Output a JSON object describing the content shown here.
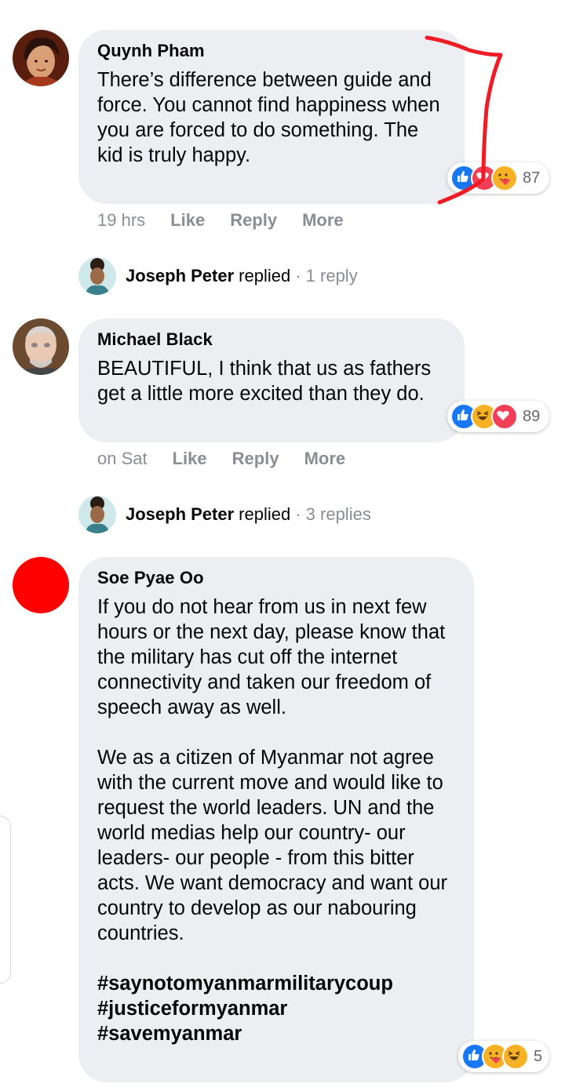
{
  "comments": [
    {
      "author": "Quynh Pham",
      "text": [
        "There’s difference between guide and force. You cannot find happiness when you are forced to do something. The kid is truly happy."
      ],
      "time": "19 hrs",
      "actions": [
        "Like",
        "Reply",
        "More"
      ],
      "reactions": [
        "like",
        "love",
        "care"
      ],
      "reaction_count": "87",
      "reply": {
        "name": "Joseph Peter",
        "verb": "replied",
        "count": "· 1 reply"
      }
    },
    {
      "author": "Michael Black",
      "text": [
        "BEAUTIFUL, I think that us as fathers get a little more excited than they do."
      ],
      "time": "on Sat",
      "actions": [
        "Like",
        "Reply",
        "More"
      ],
      "reactions": [
        "like",
        "haha",
        "love"
      ],
      "reaction_count": "89",
      "reply": {
        "name": "Joseph Peter",
        "verb": "replied",
        "count": "· 3 replies"
      }
    },
    {
      "author": "Soe Pyae Oo",
      "paragraph1": "If you do not hear from us in next few hours or the next day, please know that the military has cut off the internet connectivity and taken our freedom of speech away as well.",
      "paragraph2": "We as a citizen of Myanmar not agree with the current move and would like to request the world leaders. UN and the world medias help our country- our leaders- our people - from this bitter acts. We want democracy and want our country to develop as our nabouring countries.",
      "hashtags": [
        "#saynotomyanmarmilitarycoup",
        "#justiceformyanmar",
        "#savemyanmar"
      ],
      "reactions": [
        "like",
        "care",
        "haha"
      ],
      "reaction_count": "5"
    }
  ],
  "colors": {
    "bubble": "#eceef1",
    "meta_gray": "#8a8d91",
    "like_blue": "#1877f2",
    "love_red": "#f33e58",
    "emoji_yellow": "#f7b125",
    "annotation_red": "#ee1c24",
    "red_avatar": "#ff0000"
  },
  "icons": [
    "like-reaction-icon",
    "love-reaction-icon",
    "care-reaction-icon",
    "haha-reaction-icon"
  ]
}
